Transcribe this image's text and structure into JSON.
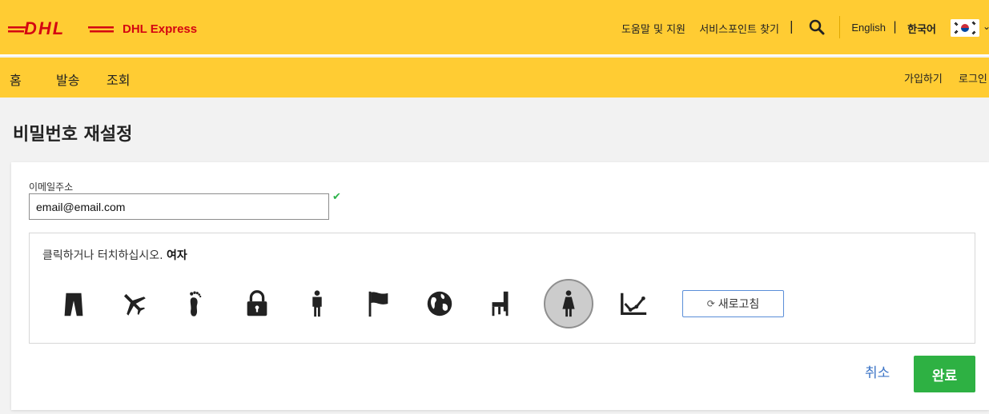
{
  "header": {
    "brand": "DHL Express",
    "help": "도움말 및 지원",
    "service_points": "서비스포인트 찾기",
    "lang_en": "English",
    "lang_ko": "한국어",
    "separator": "|"
  },
  "nav": {
    "home": "홈",
    "ship": "발송",
    "track": "조회",
    "signup": "가입하기",
    "login": "로그인"
  },
  "page": {
    "title": "비밀번호 재설정"
  },
  "form": {
    "email_label": "이메일주소",
    "email_value": "email@email.com",
    "check": "✔"
  },
  "captcha": {
    "instruction": "클릭하거나 터치하십시오.",
    "target": "여자",
    "icons": [
      "pants-icon",
      "airplane-icon",
      "footprint-icon",
      "lock-icon",
      "man-icon",
      "flag-icon",
      "globe-icon",
      "chair-icon",
      "woman-icon",
      "chart-icon"
    ],
    "selected_icon": "woman-icon",
    "refresh_label": "새로고침",
    "refresh_icon": "refresh-icon"
  },
  "actions": {
    "cancel": "취소",
    "done": "완료"
  },
  "colors": {
    "brand_yellow": "#ffcc33",
    "brand_red": "#d40511",
    "success": "#2eb143",
    "link": "#3c74c6"
  }
}
